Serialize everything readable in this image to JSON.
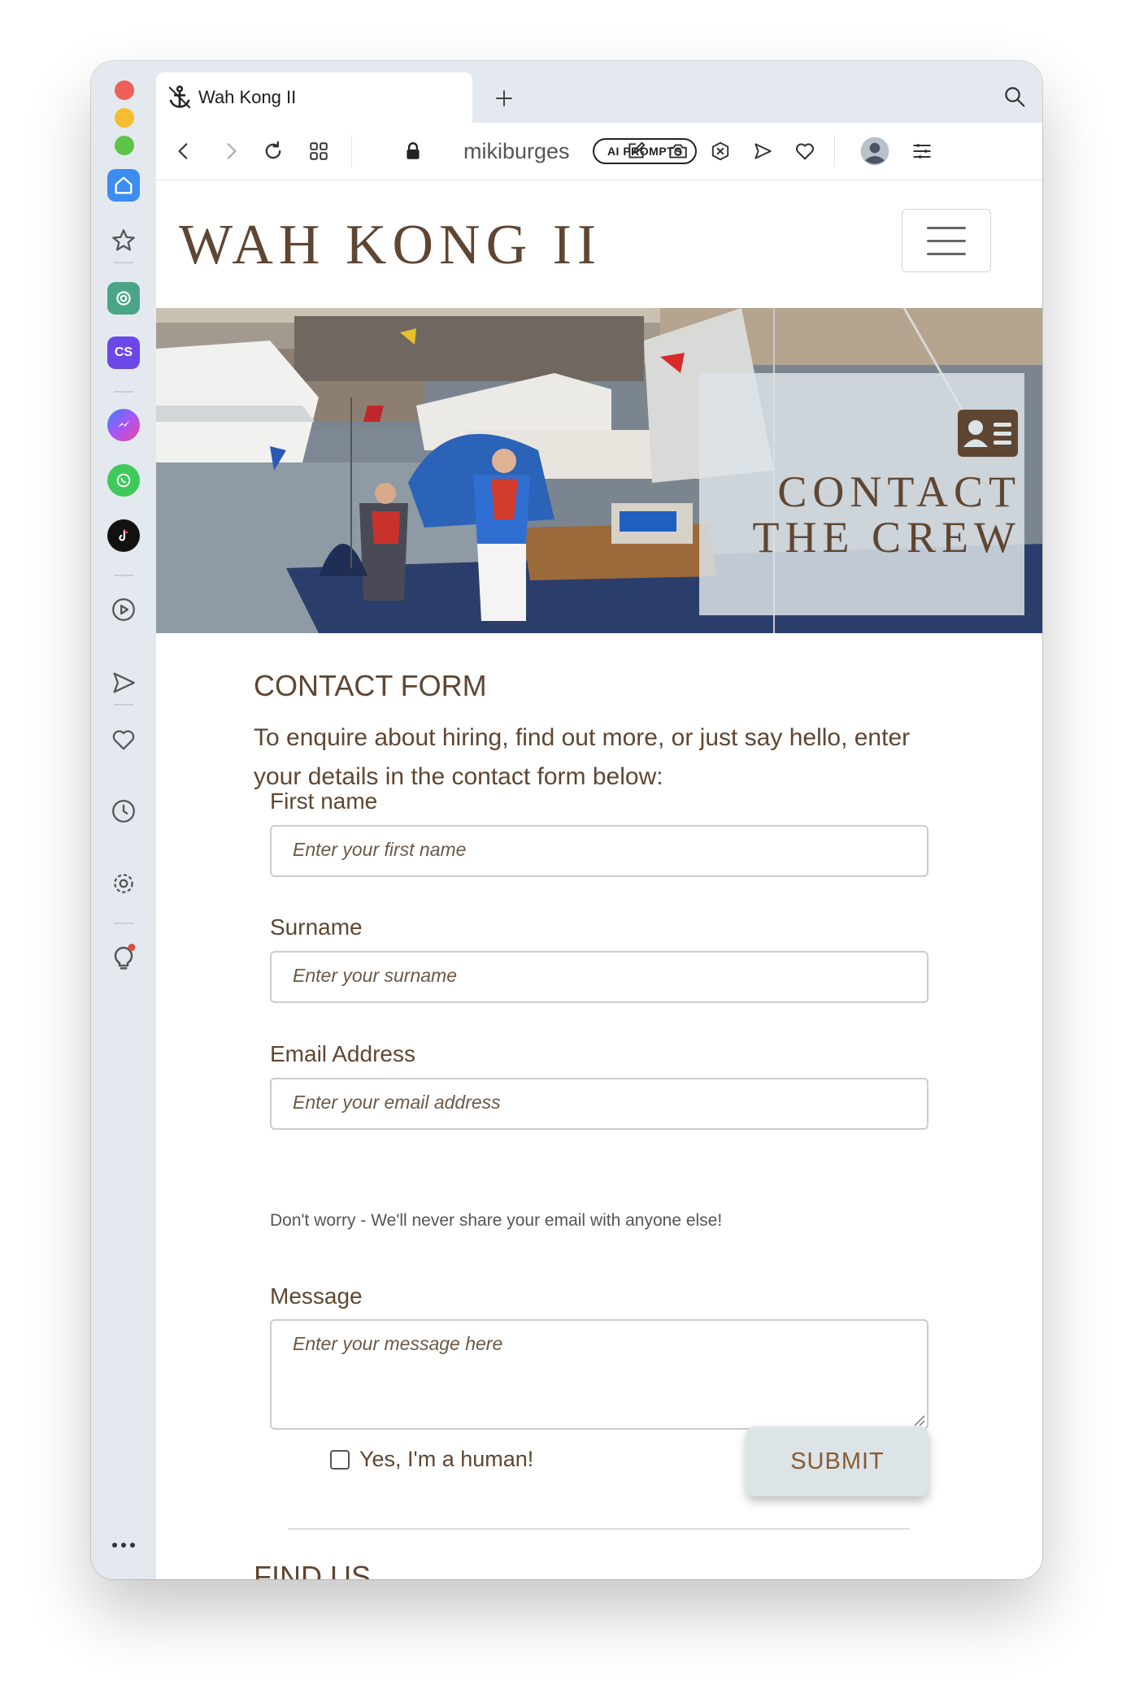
{
  "browser": {
    "tab_title": "Wah Kong II",
    "url_text": "mikiburges",
    "ai_button_label": "AI PROMPTS"
  },
  "icons": {
    "traffic_lights": [
      "close-light",
      "minimize-light",
      "zoom-light"
    ],
    "sidebar": [
      "home-icon",
      "star-icon",
      "chatgpt-icon",
      "cs-icon",
      "messenger-icon",
      "whatsapp-icon",
      "tiktok-icon",
      "play-icon",
      "send-icon",
      "heart-icon",
      "clock-icon",
      "gear-icon",
      "lightbulb-icon",
      "more-icon"
    ],
    "toolbar": [
      "back-icon",
      "forward-icon",
      "reload-icon",
      "tabs-grid-icon",
      "lock-icon",
      "edit-icon",
      "camera-icon",
      "close-circle-icon",
      "send-icon",
      "heart-icon",
      "avatar-icon",
      "menu-lines-icon"
    ]
  },
  "sidebar": {
    "cs_badge_label": "CS"
  },
  "site": {
    "brand": "WAH KONG II",
    "hero_title_line1": "CONTACT",
    "hero_title_line2": "THE CREW"
  },
  "form": {
    "heading": "CONTACT FORM",
    "intro": "To enquire about hiring, find out more, or just say hello, enter your details in the contact form below:",
    "first_name_label": "First name",
    "first_name_placeholder": "Enter your first name",
    "surname_label": "Surname",
    "surname_placeholder": "Enter your surname",
    "email_label": "Email Address",
    "email_placeholder": "Enter your email address",
    "email_help": "Don't worry - We'll never share your email with anyone else!",
    "message_label": "Message",
    "message_placeholder": "Enter your message here",
    "human_label": "Yes, I'm a human!",
    "human_checked": false,
    "submit_label": "SUBMIT"
  },
  "find_us": {
    "heading": "FIND US"
  },
  "colors": {
    "brand_brown": "#5f4632",
    "submit_text": "#8a5a2e",
    "submit_bg": "#dce4e8",
    "sidebar_bg": "#e4e9f0",
    "home_active": "#3d8cf0"
  }
}
